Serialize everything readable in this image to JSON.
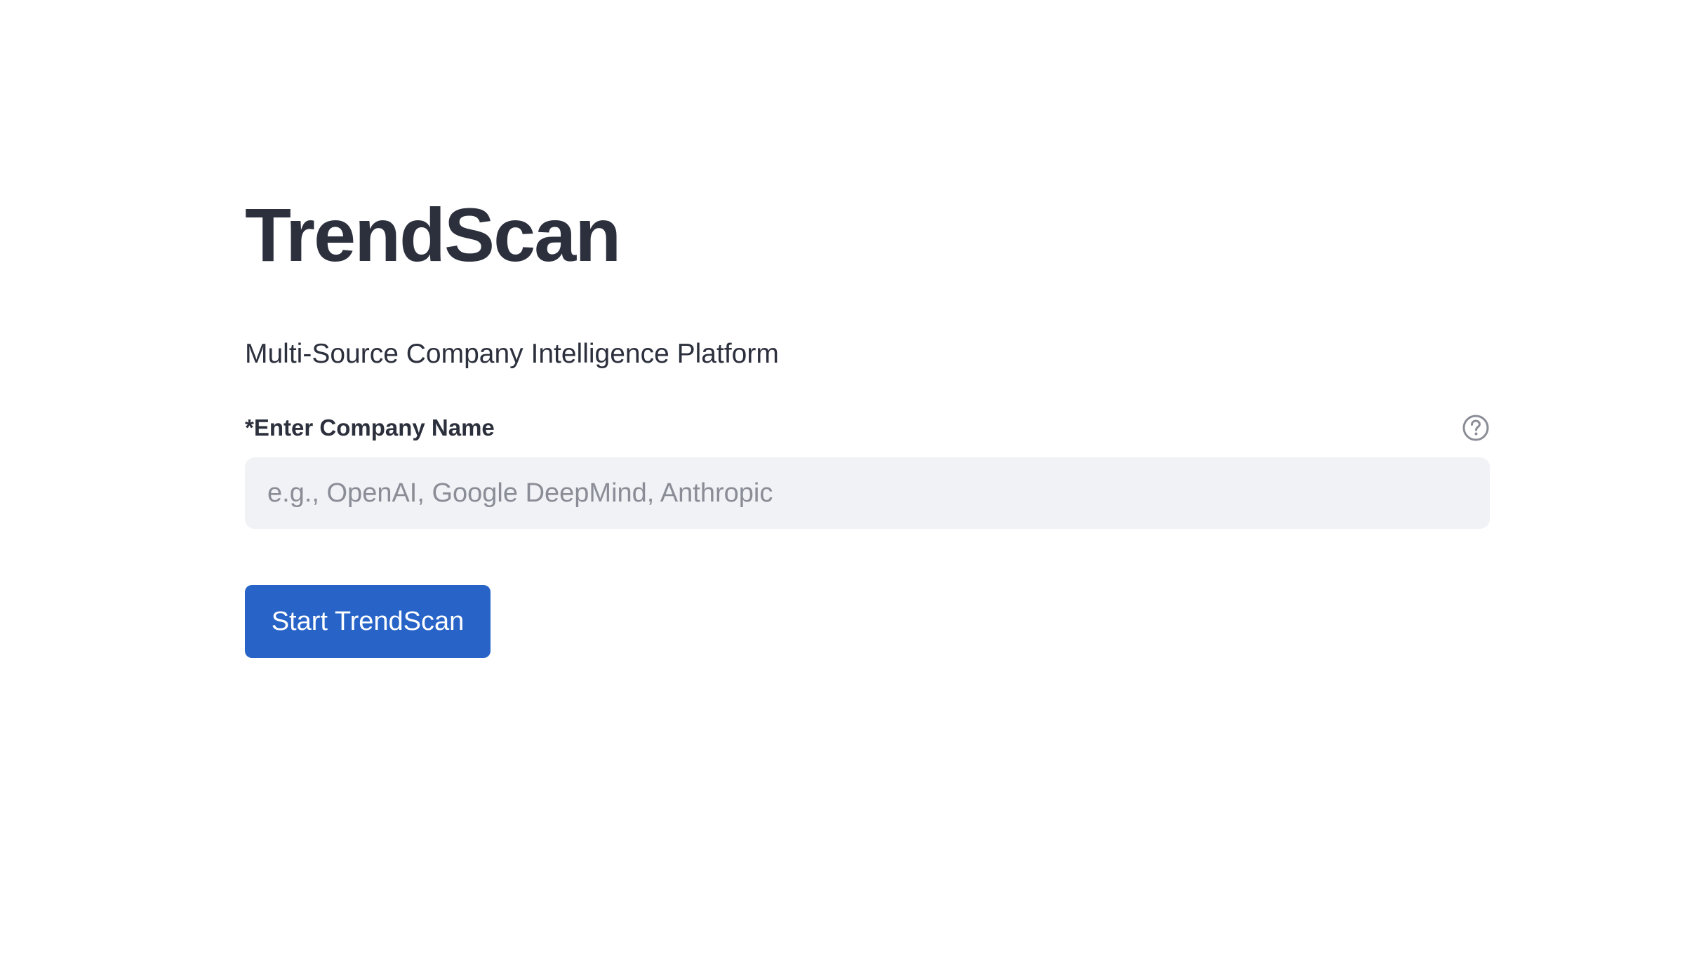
{
  "app": {
    "title": "TrendScan",
    "subtitle": "Multi-Source Company Intelligence Platform"
  },
  "form": {
    "company_label": "*Enter Company Name",
    "company_placeholder": "e.g., OpenAI, Google DeepMind, Anthropic",
    "company_value": "",
    "help_icon": "question-circle-icon",
    "submit_label": "Start TrendScan"
  },
  "colors": {
    "accent": "#2864c8",
    "input_background": "#f0f2f6",
    "text": "#2c303d",
    "placeholder": "#8a8d96"
  }
}
